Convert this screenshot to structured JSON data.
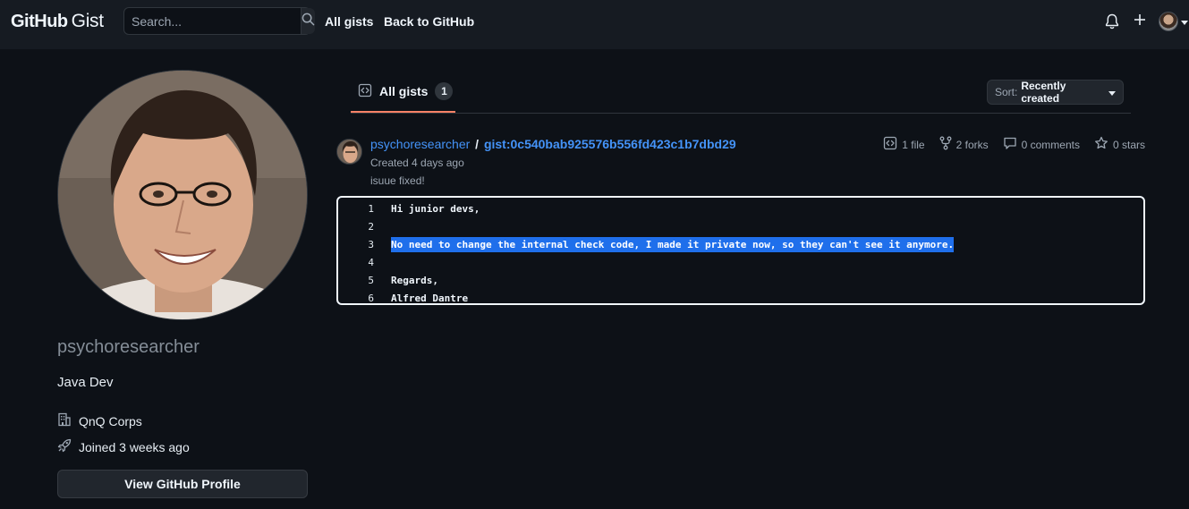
{
  "header": {
    "logo_github": "GitHub",
    "logo_gist": "Gist",
    "search_placeholder": "Search...",
    "nav": {
      "all_gists": "All gists",
      "back_to_github": "Back to GitHub"
    }
  },
  "profile": {
    "username": "psychoresearcher",
    "bio": "Java Dev",
    "company": "QnQ Corps",
    "joined": "Joined 3 weeks ago",
    "view_profile_button": "View GitHub Profile"
  },
  "tabs": {
    "all_gists_label": "All gists",
    "all_gists_count": "1"
  },
  "sort": {
    "label": "Sort:",
    "value": "Recently created"
  },
  "gist": {
    "owner": "psychoresearcher",
    "separator": "/",
    "name": "gist:0c540bab925576b556fd423c1b7dbd29",
    "created": "Created 4 days ago",
    "description": "isuue fixed!",
    "stats": {
      "files": "1 file",
      "forks": "2 forks",
      "comments": "0 comments",
      "stars": "0 stars"
    },
    "lines": [
      {
        "num": "1",
        "text": "Hi junior devs,"
      },
      {
        "num": "2",
        "text": ""
      },
      {
        "num": "3",
        "text": "No need to change the internal check code, I made it private now, so they can't see it anymore."
      },
      {
        "num": "4",
        "text": ""
      },
      {
        "num": "5",
        "text": "Regards,"
      },
      {
        "num": "6",
        "text": "Alfred Dantre"
      }
    ]
  },
  "colors": {
    "accent_link": "#4493f8",
    "tab_underline": "#f78166",
    "selection": "#1f6feb"
  }
}
